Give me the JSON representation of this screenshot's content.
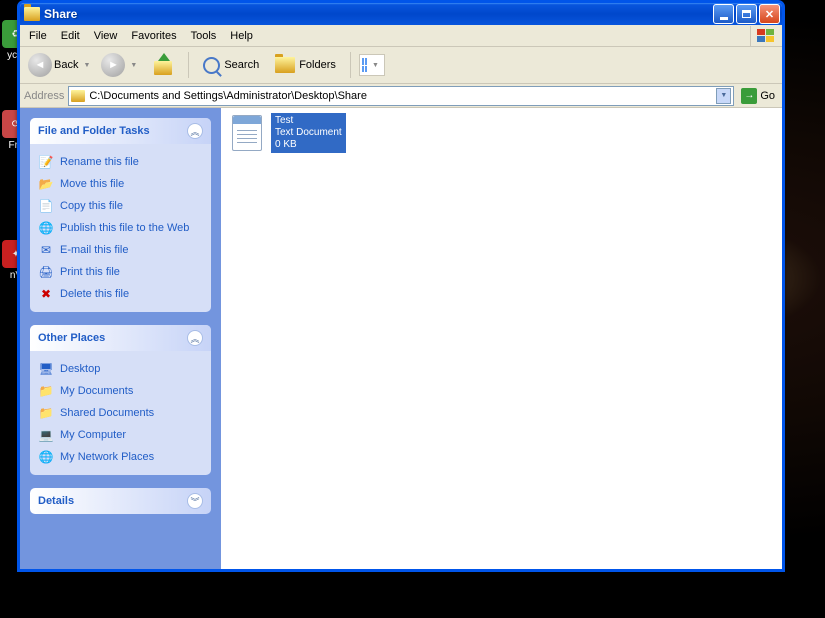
{
  "window": {
    "title": "Share"
  },
  "menu": {
    "file": "File",
    "edit": "Edit",
    "view": "View",
    "favorites": "Favorites",
    "tools": "Tools",
    "help": "Help"
  },
  "toolbar": {
    "back": "Back",
    "search": "Search",
    "folders": "Folders"
  },
  "address": {
    "label": "Address",
    "path": "C:\\Documents and Settings\\Administrator\\Desktop\\Share",
    "go": "Go"
  },
  "panels": {
    "tasks": {
      "title": "File and Folder Tasks",
      "items": {
        "rename": "Rename this file",
        "move": "Move this file",
        "copy": "Copy this file",
        "publish": "Publish this file to the Web",
        "email": "E-mail this file",
        "print": "Print this file",
        "delete": "Delete this file"
      }
    },
    "other": {
      "title": "Other Places",
      "items": {
        "desktop": "Desktop",
        "mydocs": "My Documents",
        "shared": "Shared Documents",
        "mycomp": "My Computer",
        "network": "My Network Places"
      }
    },
    "details": {
      "title": "Details"
    }
  },
  "file": {
    "name": "Test",
    "type": "Text Document",
    "size": "0 KB"
  },
  "desktop_icons": {
    "recycle": "ycle",
    "fre": "Fre",
    "nv": "nV"
  }
}
